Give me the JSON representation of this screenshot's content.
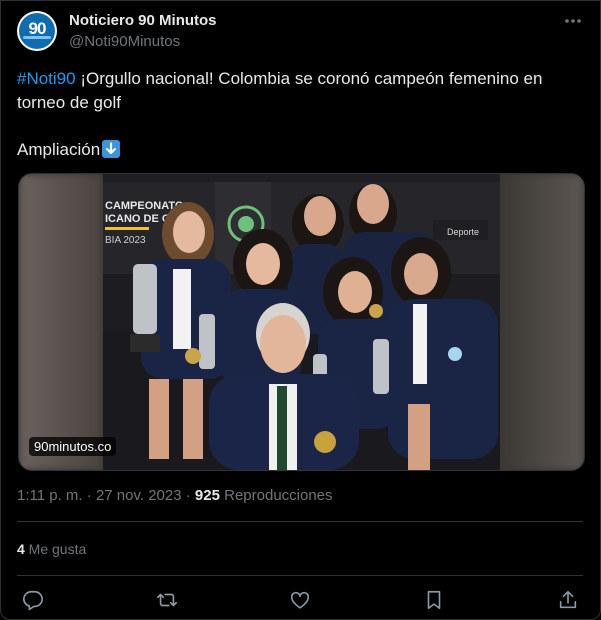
{
  "account": {
    "avatar_text": "90",
    "display_name": "Noticiero 90 Minutos",
    "handle": "@Noti90Minutos"
  },
  "post": {
    "hashtag": "#Noti90",
    "text": " ¡Orgullo nacional! Colombia se coronó campeón femenino en torneo de golf",
    "text2": "Ampliación",
    "emoji_icon": "down-arrow-emoji",
    "media_watermark": "90minutos.co",
    "photo_text": {
      "banner_line1": "CAMPEONATO",
      "banner_line2": "ICANO DE GOLF",
      "banner_line3": "BIA 2023",
      "sponsor": "Deporte"
    }
  },
  "meta": {
    "time": "1:11 p. m.",
    "sep": " · ",
    "date": "27 nov. 2023",
    "views_count": "925",
    "views_label": " Reproducciones"
  },
  "stats": {
    "likes_count": "4",
    "likes_label": " Me gusta"
  },
  "actions": [
    "reply-icon",
    "repost-icon",
    "like-icon",
    "bookmark-icon",
    "share-icon"
  ],
  "colors": {
    "accent": "#1d9bf0",
    "muted": "#71767b",
    "text": "#e7e9ea",
    "border": "#2f3336",
    "bg": "#000000"
  }
}
